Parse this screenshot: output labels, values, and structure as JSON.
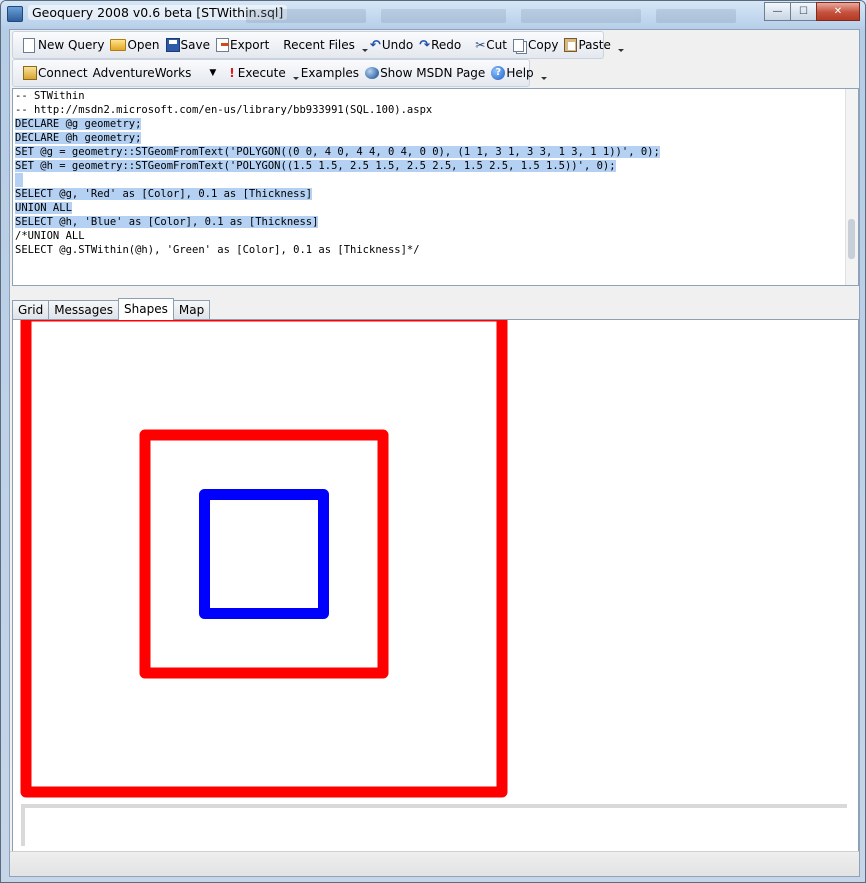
{
  "window": {
    "title": "Geoquery 2008 v0.6 beta [STWithin.sql]",
    "controls": {
      "minimize": "—",
      "maximize": "☐",
      "close": "✕"
    }
  },
  "toolbar_main": {
    "new_query": "New Query",
    "open": "Open",
    "save": "Save",
    "export": "Export",
    "recent_files": "Recent Files",
    "undo": "Undo",
    "redo": "Redo",
    "cut": "Cut",
    "copy": "Copy",
    "paste": "Paste"
  },
  "toolbar_query": {
    "connect": "Connect",
    "database": "AdventureWorks",
    "execute": "Execute",
    "examples": "Examples",
    "show_msdn": "Show MSDN Page",
    "help": "Help"
  },
  "editor": {
    "lines": [
      {
        "text": "-- STWithin",
        "selected": false
      },
      {
        "text": "-- http://msdn2.microsoft.com/en-us/library/bb933991(SQL.100).aspx",
        "selected": false
      },
      {
        "text": "DECLARE @g geometry;",
        "selected": true
      },
      {
        "text": "DECLARE @h geometry;",
        "selected": true
      },
      {
        "text": "SET @g = geometry::STGeomFromText('POLYGON((0 0, 4 0, 4 4, 0 4, 0 0), (1 1, 3 1, 3 3, 1 3, 1 1))', 0);",
        "selected": true
      },
      {
        "text": "SET @h = geometry::STGeomFromText('POLYGON((1.5 1.5, 2.5 1.5, 2.5 2.5, 1.5 2.5, 1.5 1.5))', 0);",
        "selected": true
      },
      {
        "text": "",
        "selected": true
      },
      {
        "text": "SELECT @g, 'Red' as [Color], 0.1 as [Thickness]",
        "selected": true
      },
      {
        "text": "UNION ALL",
        "selected": true
      },
      {
        "text": "SELECT @h, 'Blue' as [Color], 0.1 as [Thickness]",
        "selected": true
      },
      {
        "text": "/*UNION ALL",
        "selected": false
      },
      {
        "text": "SELECT @g.STWithin(@h), 'Green' as [Color], 0.1 as [Thickness]*/",
        "selected": false
      }
    ]
  },
  "result_tabs": [
    {
      "label": "Grid",
      "active": false
    },
    {
      "label": "Messages",
      "active": false
    },
    {
      "label": "Shapes",
      "active": true
    },
    {
      "label": "Map",
      "active": false
    }
  ],
  "shapes": {
    "world_extent": [
      0,
      4
    ],
    "items": [
      {
        "name": "outer-ring",
        "color": "#ff0000",
        "ring": [
          [
            0,
            0
          ],
          [
            4,
            0
          ],
          [
            4,
            4
          ],
          [
            0,
            4
          ]
        ]
      },
      {
        "name": "inner-ring",
        "color": "#ff0000",
        "ring": [
          [
            1,
            1
          ],
          [
            3,
            1
          ],
          [
            3,
            3
          ],
          [
            1,
            3
          ]
        ]
      },
      {
        "name": "blue-polygon",
        "color": "#0000ff",
        "ring": [
          [
            1.5,
            1.5
          ],
          [
            2.5,
            1.5
          ],
          [
            2.5,
            2.5
          ],
          [
            1.5,
            2.5
          ]
        ]
      }
    ]
  }
}
